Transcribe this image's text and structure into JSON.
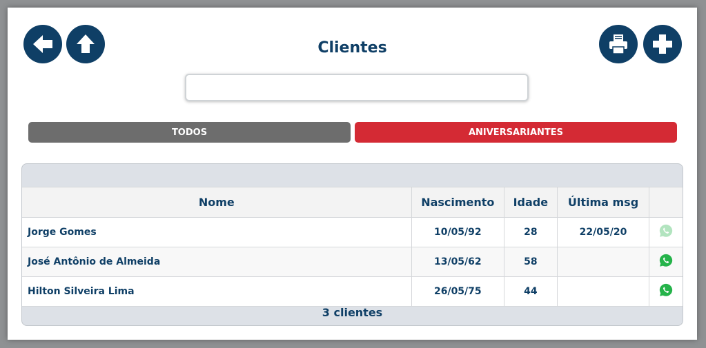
{
  "header": {
    "title": "Clientes",
    "back_icon": "arrow-left-icon",
    "up_icon": "arrow-up-icon",
    "print_icon": "printer-icon",
    "add_icon": "plus-icon"
  },
  "search": {
    "value": "",
    "placeholder": ""
  },
  "tabs": [
    {
      "label": "TODOS",
      "color": "#6d6d6d"
    },
    {
      "label": "ANIVERSARIANTES",
      "color": "#d42a34",
      "active": true
    }
  ],
  "table": {
    "columns": [
      "Nome",
      "Nascimento",
      "Idade",
      "Última msg",
      ""
    ],
    "rows": [
      {
        "nome": "Jorge Gomes",
        "nascimento": "10/05/92",
        "idade": "28",
        "ultima_msg": "22/05/20",
        "whatsapp_icon": "whatsapp-icon",
        "whatsapp_faded": true
      },
      {
        "nome": "José Antônio de Almeida",
        "nascimento": "13/05/62",
        "idade": "58",
        "ultima_msg": "",
        "whatsapp_icon": "whatsapp-icon",
        "whatsapp_faded": false
      },
      {
        "nome": "Hilton Silveira Lima",
        "nascimento": "26/05/75",
        "idade": "44",
        "ultima_msg": "",
        "whatsapp_icon": "whatsapp-icon",
        "whatsapp_faded": false
      }
    ],
    "footer": "3 clientes"
  },
  "colors": {
    "primary": "#0f3f66",
    "whatsapp": "#25b34a"
  }
}
